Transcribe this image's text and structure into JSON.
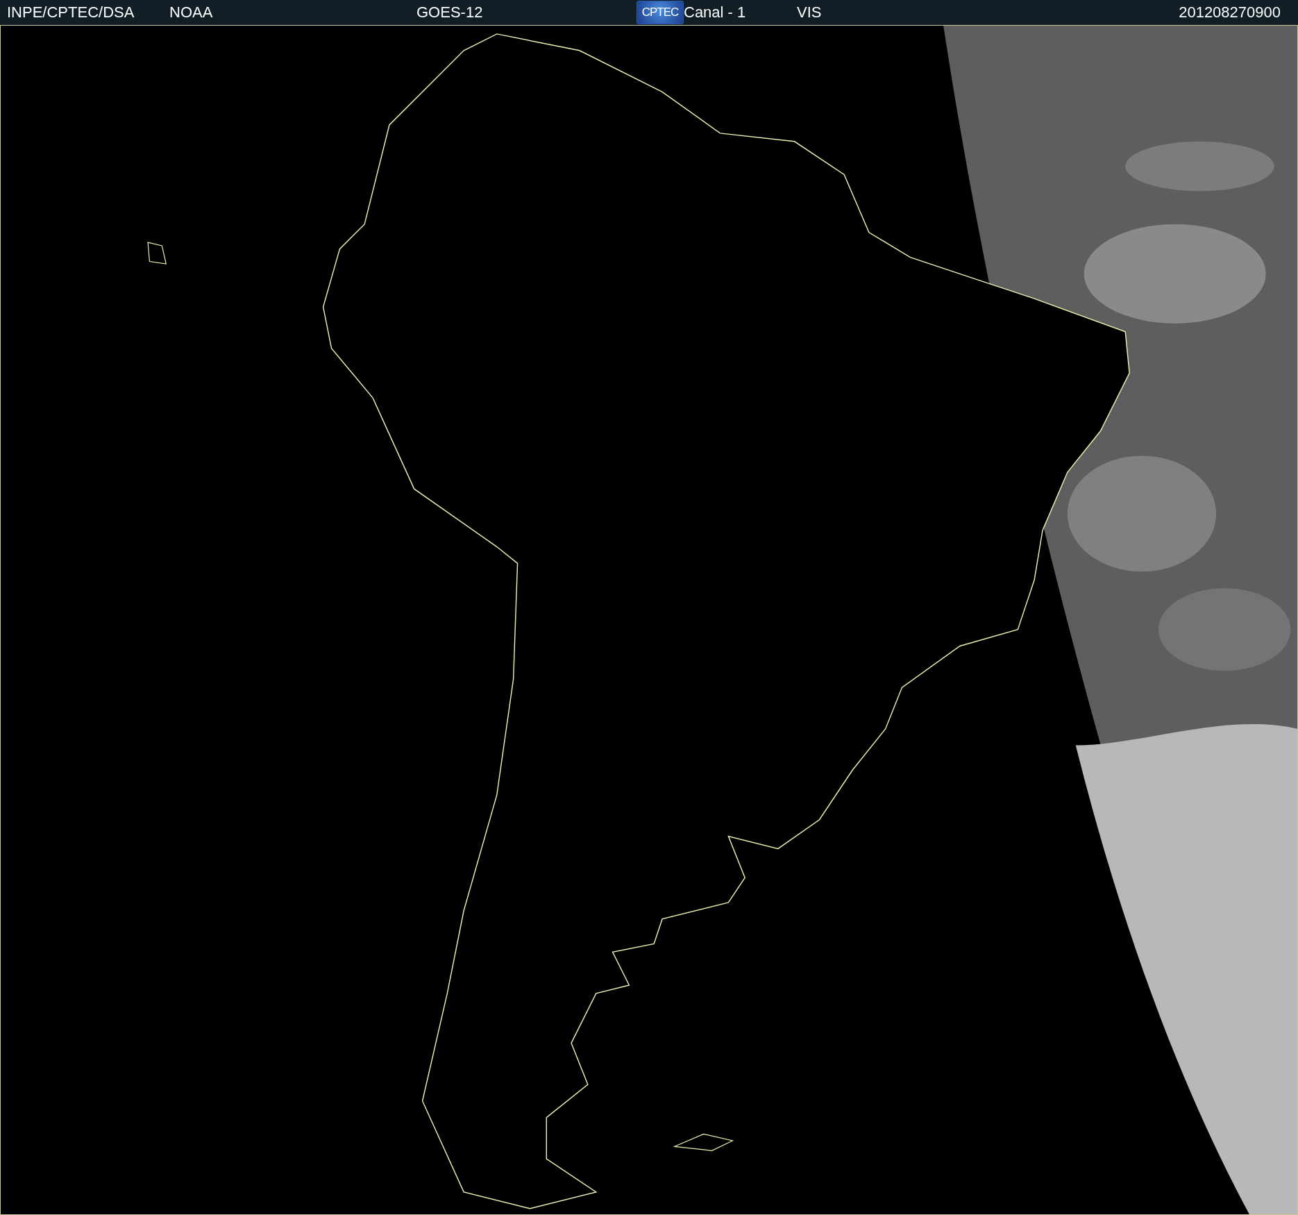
{
  "header": {
    "items": [
      {
        "kind": "text",
        "text": "INPE/CPTEC/DSA"
      },
      {
        "kind": "text",
        "text": "NOAA"
      },
      {
        "kind": "text",
        "text": "GOES-12"
      },
      {
        "kind": "logo",
        "text": "CPTEC"
      },
      {
        "kind": "text",
        "text": "Canal - 1"
      },
      {
        "kind": "text",
        "text": "VIS"
      },
      {
        "kind": "text",
        "text": "201208270900"
      }
    ]
  }
}
